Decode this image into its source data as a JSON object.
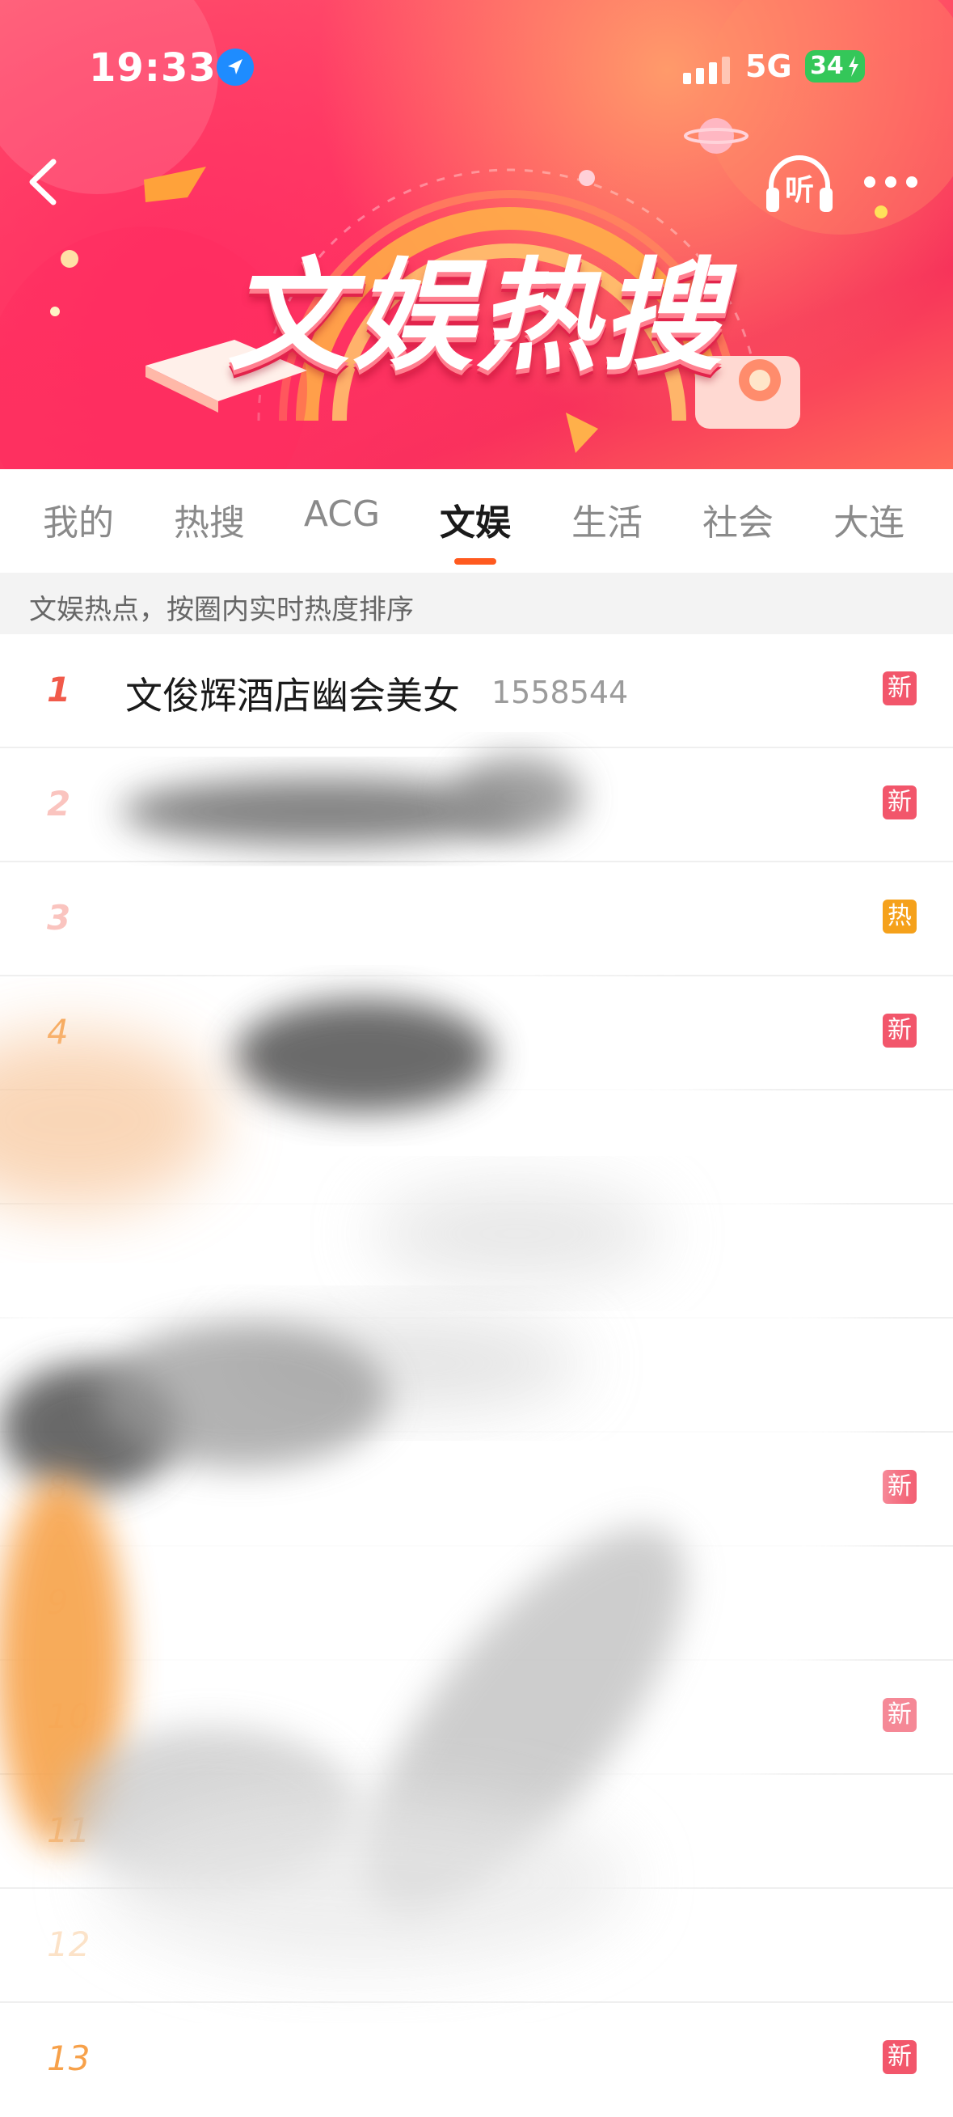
{
  "status": {
    "time": "19:33",
    "network": "5G",
    "battery": "34"
  },
  "header": {
    "title": "文娱热搜",
    "listen_label": "听"
  },
  "tabs": [
    {
      "label": "我的",
      "active": false
    },
    {
      "label": "热搜",
      "active": false
    },
    {
      "label": "ACG",
      "active": false
    },
    {
      "label": "文娱",
      "active": true
    },
    {
      "label": "生活",
      "active": false
    },
    {
      "label": "社会",
      "active": false
    },
    {
      "label": "大连",
      "active": false
    }
  ],
  "notice": "文娱热点，按圈内实时热度排序",
  "list": {
    "items": [
      {
        "rank": "1",
        "title": "文俊辉酒店幽会美女",
        "count": "1558544",
        "badge": "新"
      },
      {
        "rank": "2",
        "title": "",
        "count": "",
        "badge": "新"
      },
      {
        "rank": "3",
        "title": "",
        "count": "",
        "badge": "热"
      },
      {
        "rank": "4",
        "title": "",
        "count": "",
        "badge": "新"
      },
      {
        "rank": "",
        "title": "",
        "count": "",
        "badge": ""
      },
      {
        "rank": "",
        "title": "",
        "count": "",
        "badge": ""
      },
      {
        "rank": "",
        "title": "",
        "count": "",
        "badge": ""
      },
      {
        "rank": "8",
        "title": "",
        "count": "",
        "badge": "新"
      },
      {
        "rank": "9",
        "title": "",
        "count": "",
        "badge": ""
      },
      {
        "rank": "10",
        "title": "",
        "count": "",
        "badge": "新"
      },
      {
        "rank": "11",
        "title": "",
        "count": "",
        "badge": ""
      },
      {
        "rank": "12",
        "title": "",
        "count": "",
        "badge": ""
      },
      {
        "rank": "13",
        "title": "",
        "count": "",
        "badge": "新"
      }
    ]
  },
  "colors": {
    "accent": "#ff5a1f",
    "rank_red": "#f15a4a",
    "rank_orange": "#f7a14a",
    "badge_new": "#f2566b",
    "badge_hot": "#f5a11b"
  },
  "icons": {
    "back": "chevron-left-icon",
    "listen": "headphones-icon",
    "more": "more-dots-icon",
    "location": "location-arrow-icon"
  }
}
